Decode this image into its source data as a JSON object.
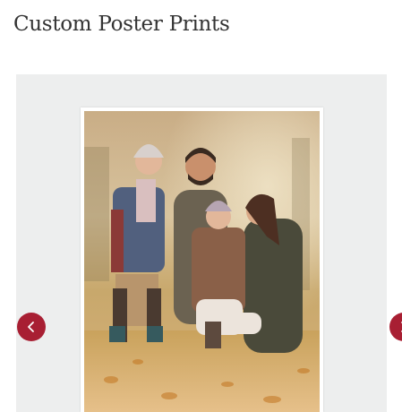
{
  "page": {
    "title": "Custom Poster Prints"
  },
  "carousel": {
    "prev_icon": "chevron-left-icon",
    "next_icon": "chevron-right-icon",
    "accent_color": "#a81f33",
    "background_color": "#edeeee",
    "slide": {
      "content": "family-autumn-photo-poster"
    }
  }
}
